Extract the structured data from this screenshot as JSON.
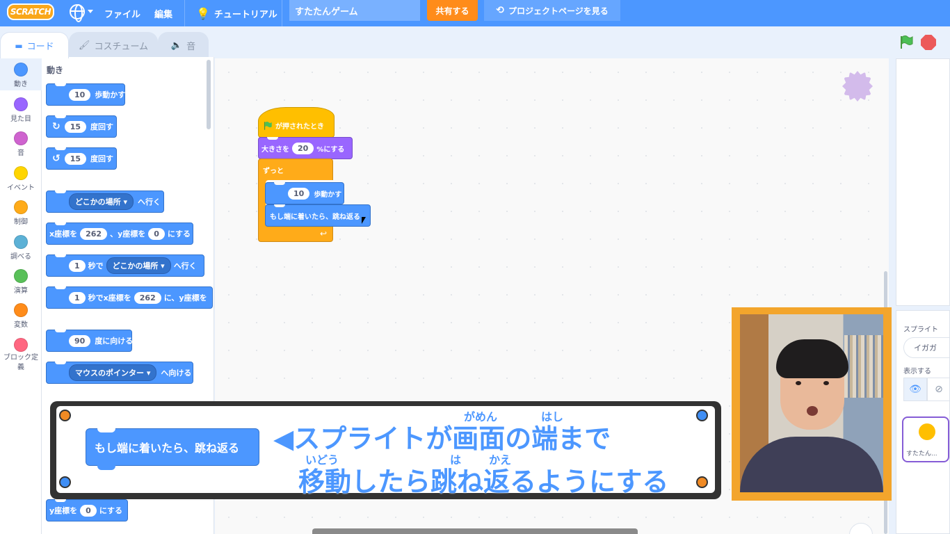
{
  "menubar": {
    "logo": "SCRATCH",
    "file": "ファイル",
    "edit": "編集",
    "tutorial": "チュートリアル",
    "project_title": "すたたんゲーム",
    "share": "共有する",
    "project_page": "プロジェクトページを見る"
  },
  "tabs": {
    "code": "コード",
    "costumes": "コスチューム",
    "sounds": "音"
  },
  "categories": [
    {
      "label": "動き",
      "color": "#4c97ff"
    },
    {
      "label": "見た目",
      "color": "#9966ff"
    },
    {
      "label": "音",
      "color": "#cf63cf"
    },
    {
      "label": "イベント",
      "color": "#ffd500"
    },
    {
      "label": "制御",
      "color": "#ffab19"
    },
    {
      "label": "調べる",
      "color": "#5cb1d6"
    },
    {
      "label": "演算",
      "color": "#59c059"
    },
    {
      "label": "変数",
      "color": "#ff8c1a"
    },
    {
      "label": "ブロック定義",
      "color": "#ff6680"
    }
  ],
  "palette": {
    "title": "動き",
    "move_value": "10",
    "move_label": "歩動かす",
    "turn_right_value": "15",
    "turn_left_value": "15",
    "turn_label": "度回す",
    "goto_dropdown": "どこかの場所",
    "goto_label": "へ行く",
    "goxy_x_label": "x座標を",
    "goxy_x": "262",
    "goxy_y_label": "、y座標を",
    "goxy_y": "0",
    "goxy_end": "にする",
    "glide_secs": "1",
    "glide_label": "秒で",
    "glide_dropdown": "どこかの場所",
    "glide_end": "へ行く",
    "glidexy_secs": "1",
    "glidexy_label": "秒でx座標を",
    "glidexy_x": "262",
    "glidexy_mid": "に、y座標を",
    "point_value": "90",
    "point_label": "度に向ける",
    "towards_dropdown": "マウスのポインター",
    "towards_label": "へ向ける",
    "sety_label": "y座標を",
    "sety_value": "0",
    "sety_end": "にする"
  },
  "script": {
    "hat_label": "が押されたとき",
    "size_label": "大きさを",
    "size_value": "20",
    "size_end": "%にする",
    "forever_label": "ずっと",
    "move_value": "10",
    "move_label": "歩動かす",
    "bounce_label": "もし端に着いたら、跳ね返る"
  },
  "sprite_panel": {
    "sprite_label": "スプライト",
    "sprite_name": "イガガ",
    "show_label": "表示する",
    "thumb_name": "すたたん..."
  },
  "banner": {
    "block_label": "もし端に着いたら、跳ね返る",
    "line1": "◀スプライトが画面の端まで",
    "line2": "移動したら跳ね返るようにする",
    "ruby_gamen": "がめん",
    "ruby_hashi": "はし",
    "ruby_idou": "いどう",
    "ruby_ha": "は",
    "ruby_kae": "かえ"
  }
}
